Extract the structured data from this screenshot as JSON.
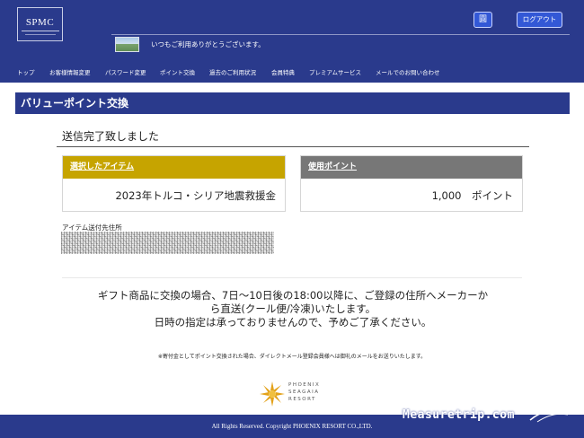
{
  "header": {
    "logo_text": "SPMC",
    "greeting": "いつもご利用ありがとうございます。",
    "bell_label": "圓",
    "logout_label": "ログアウト"
  },
  "nav": {
    "items": [
      {
        "label": "トップ"
      },
      {
        "label": "お客様情報変更"
      },
      {
        "label": "パスワード変更"
      },
      {
        "label": "ポイント交換"
      },
      {
        "label": "過去のご利用状況"
      },
      {
        "label": "会員特典"
      },
      {
        "label": "プレミアムサービス"
      },
      {
        "label": "メールでのお問い合わせ"
      }
    ]
  },
  "page": {
    "title": "バリューポイント交換",
    "sent_message": "送信完了致しました",
    "item_card": {
      "header": "選択したアイテム",
      "value": "2023年トルコ・シリア地震救援金"
    },
    "points_card": {
      "header": "使用ポイント",
      "value": "1,000　ポイント"
    },
    "address_label": "アイテム送付先住所",
    "notice_line1": "ギフト商品に交換の場合、7日〜10日後の18:00以降に、ご登録の住所へメーカーか",
    "notice_line2": "ら直送(クール便/冷凍)いたします。",
    "notice_line3": "日時の指定は承っておりませんので、予めご了承ください。",
    "small_note": "※寄付金としてポイント交換された場合、ダイレクトメール登録会員様へは御礼のメールをお送りいたします。"
  },
  "footer": {
    "brand_line1": "PHOENIX",
    "brand_line2": "SEAGAIA",
    "brand_line3": "RESORT",
    "copyright": "All Rights Reserved. Copyright PHOENIX RESORT CO.,LTD.",
    "watermark": "Measuretrip.com"
  },
  "colors": {
    "navy": "#2a3a8c",
    "button_blue": "#3358d6",
    "item_header_gold": "#c6a400",
    "points_header_gray": "#777777"
  }
}
